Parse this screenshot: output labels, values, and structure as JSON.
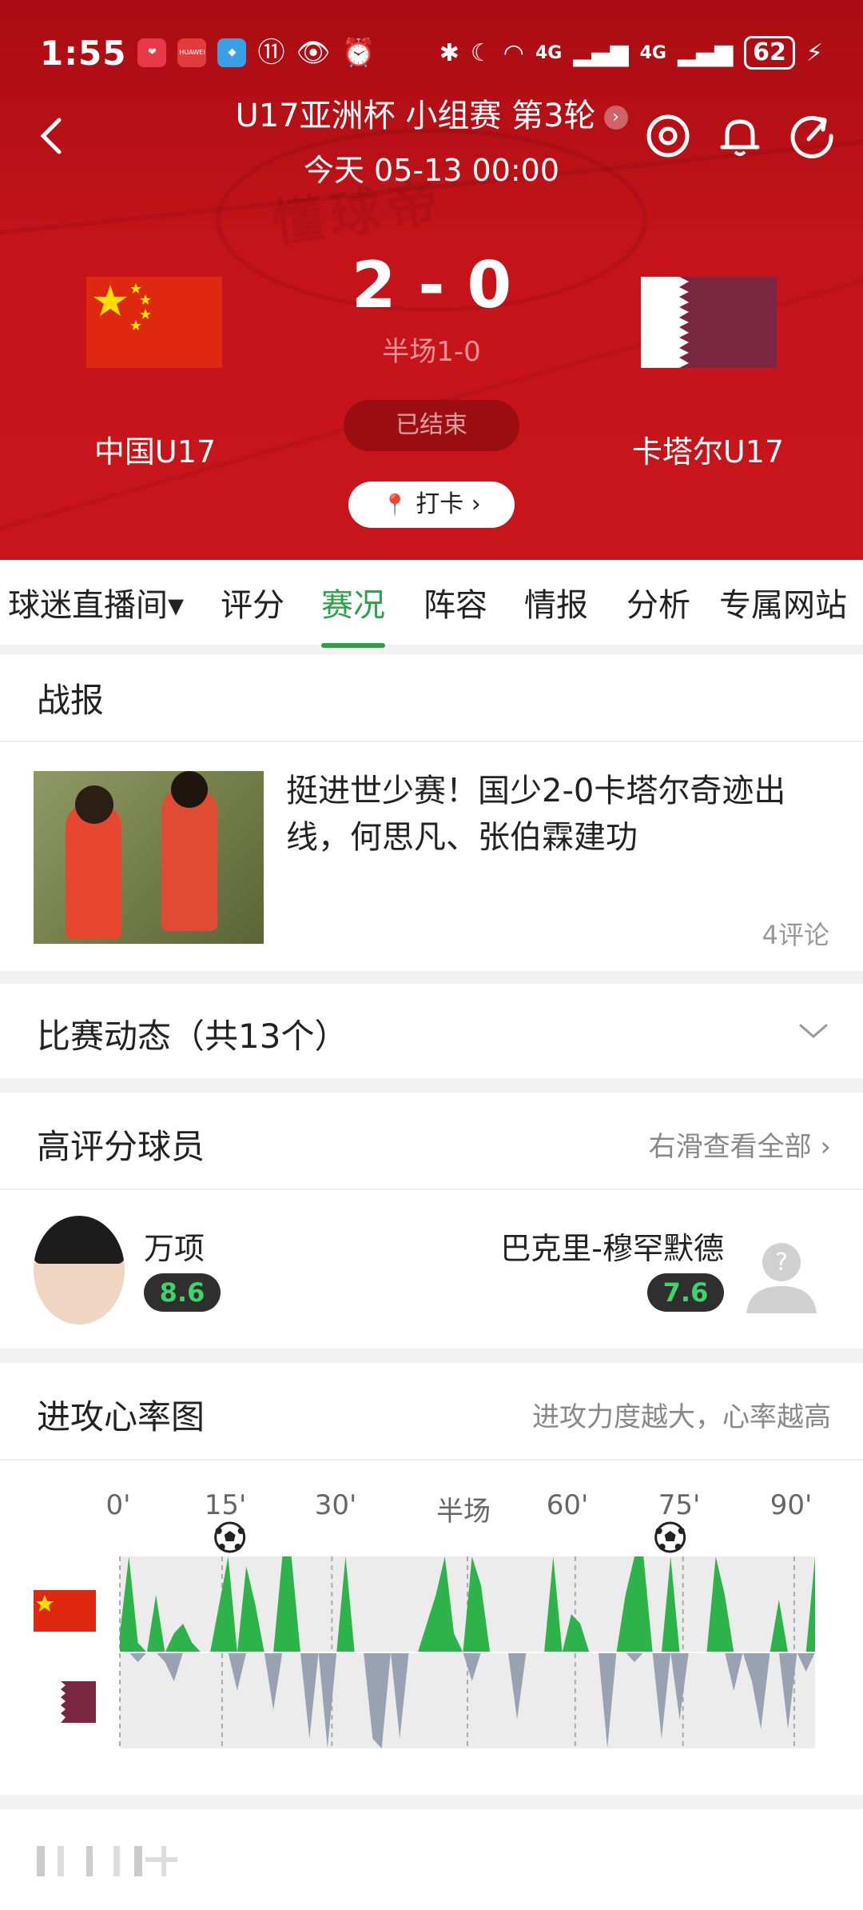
{
  "status_bar": {
    "time": "1:55",
    "battery": "62",
    "net1": "4G",
    "net2": "4G",
    "app_badge": "HUAWEI"
  },
  "header": {
    "title": "U17亚洲杯 小组赛 第3轮",
    "subtitle": "今天 05-13 00:00",
    "score": "2 - 0",
    "half_score": "半场1-0",
    "status": "已结束",
    "home_team": "中国U17",
    "away_team": "卡塔尔U17",
    "checkin_label": "打卡",
    "watermark": "懂球帝"
  },
  "tabs": [
    {
      "label": "球迷直播间▾"
    },
    {
      "label": "评分"
    },
    {
      "label": "赛况",
      "active": true
    },
    {
      "label": "阵容"
    },
    {
      "label": "情报"
    },
    {
      "label": "分析"
    },
    {
      "label": "专属网站"
    }
  ],
  "report": {
    "heading": "战报",
    "news_title": "挺进世少赛！国少2-0卡塔尔奇迹出线，何思凡、张伯霖建功",
    "comments": "4评论"
  },
  "events": {
    "heading": "比赛动态（共13个）"
  },
  "top_players": {
    "heading": "高评分球员",
    "more": "右滑查看全部",
    "home": {
      "name": "万项",
      "rating": "8.6"
    },
    "away": {
      "name": "巴克里-穆罕默德",
      "rating": "7.6"
    }
  },
  "heart_rate": {
    "heading": "进攻心率图",
    "note": "进攻力度越大，心率越高",
    "labels": [
      "0'",
      "15'",
      "30'",
      "半场",
      "60'",
      "75'",
      "90'"
    ]
  },
  "chart_data": {
    "type": "area",
    "x_labels": [
      "0'",
      "15'",
      "30'",
      "半场",
      "60'",
      "75'",
      "90'"
    ],
    "goal_minutes": [
      13,
      70
    ],
    "home_color": "#2db34a",
    "away_color": "#98a2b3",
    "home_intensity": [
      0.2,
      1.0,
      0.1,
      0.0,
      0.6,
      0.0,
      0.2,
      0.3,
      0.1,
      0.0,
      0.0,
      0.5,
      1.0,
      0.0,
      0.9,
      0.5,
      0.0,
      0.0,
      1.0,
      1.0,
      0.0,
      0.0,
      0.0,
      0.0,
      0.0,
      1.0,
      0.0,
      0.0,
      0.0,
      0.0,
      0.0,
      0.0,
      0.0,
      0.0,
      0.3,
      0.6,
      1.0,
      0.2,
      0.0,
      1.0,
      0.7,
      0.0,
      0.0,
      0.0,
      0.0,
      0.0,
      0.0,
      0.0,
      1.0,
      0.0,
      0.4,
      0.3,
      0.0,
      0.0,
      0.0,
      0.0,
      0.6,
      1.0,
      1.0,
      0.0,
      0.0,
      1.0,
      0.0,
      0.0,
      0.0,
      0.0,
      1.0,
      0.6,
      0.0,
      0.0,
      0.0,
      0.0,
      0.0,
      0.55,
      0.0,
      0.0,
      0.0,
      1.0
    ],
    "away_intensity": [
      0.0,
      0.0,
      0.1,
      0.0,
      0.0,
      0.1,
      0.3,
      0.0,
      0.0,
      0.0,
      0.0,
      0.0,
      0.0,
      0.4,
      0.0,
      0.0,
      0.0,
      0.6,
      0.0,
      0.0,
      0.0,
      0.9,
      0.0,
      1.0,
      0.0,
      0.0,
      0.0,
      0.0,
      0.9,
      1.0,
      0.0,
      0.9,
      0.0,
      0.0,
      0.0,
      0.0,
      0.0,
      0.0,
      0.0,
      0.3,
      0.0,
      0.0,
      0.0,
      0.0,
      0.7,
      0.0,
      0.0,
      0.0,
      0.0,
      0.0,
      0.0,
      0.0,
      0.0,
      0.0,
      1.0,
      0.0,
      0.0,
      0.1,
      0.0,
      0.0,
      0.9,
      0.0,
      0.7,
      0.0,
      0.0,
      0.0,
      0.0,
      0.0,
      0.4,
      0.0,
      0.3,
      0.8,
      0.0,
      0.0,
      0.8,
      0.0,
      0.2,
      0.0
    ]
  }
}
